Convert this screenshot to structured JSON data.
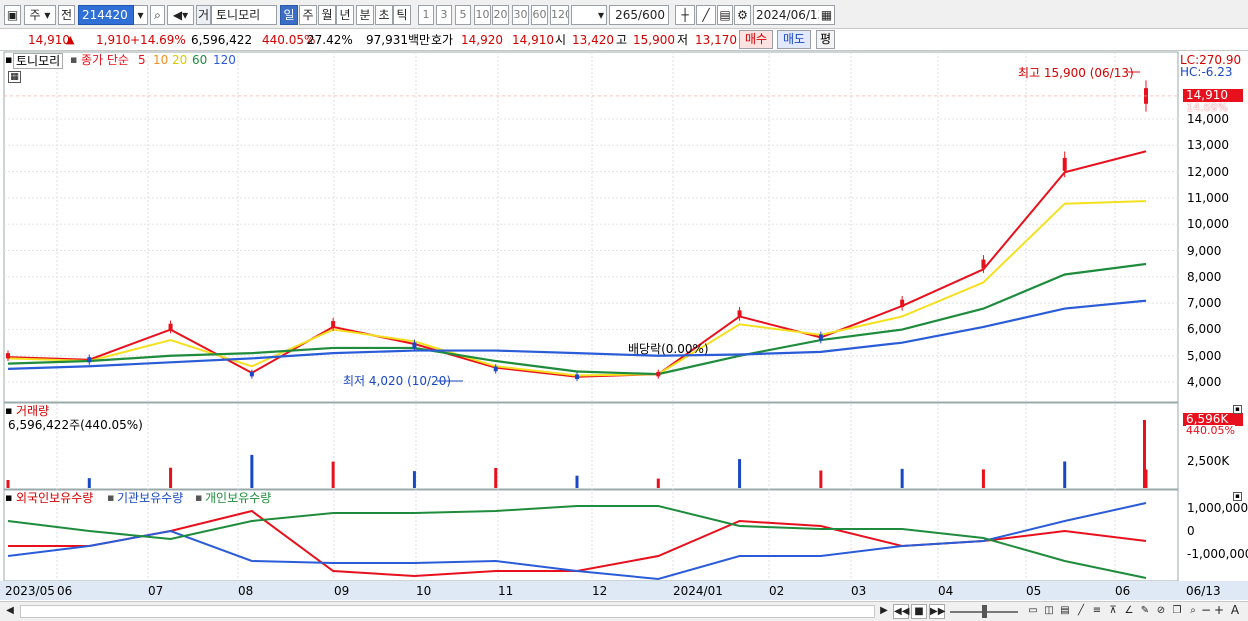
{
  "toolbar": {
    "market": "주",
    "jeon": "전",
    "code": "214420",
    "geo": "거",
    "name": "토니모리",
    "periods": [
      "일",
      "주",
      "월",
      "년",
      "분",
      "초",
      "틱"
    ],
    "selected_period": "일",
    "minutes": [
      "1",
      "3",
      "5",
      "10",
      "20",
      "30",
      "60",
      "120"
    ],
    "count": "265",
    "count_max": "/600",
    "date": "2024/06/13"
  },
  "quote": {
    "price": "14,910",
    "up_icon": "▲",
    "change": "1,910",
    "change_pct": "+14.69%",
    "volume": "6,596,422",
    "vol_ratio": "440.05%",
    "turnover": "27.42%",
    "amount": "97,931백만",
    "hoga_label": "호가",
    "ask": "14,920",
    "bid": "14,910",
    "open_label": "시",
    "open": "13,420",
    "high_label": "고",
    "high": "15,900",
    "low_label": "저",
    "low": "13,170",
    "buy_button": "매수",
    "sell_button": "매도",
    "eval_button": "평"
  },
  "price_panel": {
    "name": "토니모리",
    "ma_label": "종가 단순",
    "ma_periods": [
      "5",
      "10",
      "20",
      "60",
      "120"
    ],
    "ma_colors": [
      "#e8101c",
      "#f09020",
      "#f5e020",
      "#1e8c3c",
      "#2a5cd8"
    ],
    "lc": "LC:270.90",
    "hc": "HC:-6.23",
    "last_price": "14,910",
    "last_pct": "14.69%",
    "high_note": "최고 15,900 (06/13)",
    "low_note": "최저 4,020 (10/20)",
    "dividend_note": "배당락(0.00%)",
    "y_ticks": [
      "14,000",
      "13,000",
      "12,000",
      "11,000",
      "10,000",
      "9,000",
      "8,000",
      "7,000",
      "6,000",
      "5,000",
      "4,000"
    ]
  },
  "volume_panel": {
    "title": "거래량",
    "value": "6,596,422주(440.05%)",
    "tag": "6,596K",
    "tag_pct": "440.05%",
    "y_ticks": [
      "2,500K"
    ]
  },
  "holding_panel": {
    "foreign": "외국인보유수량",
    "institution": "기관보유수량",
    "individual": "개인보유수량",
    "y_ticks": [
      "1,000,000",
      "0",
      "-1,000,000"
    ]
  },
  "x_axis": [
    "2023/05",
    "06",
    "07",
    "08",
    "09",
    "10",
    "11",
    "12",
    "2024/01",
    "02",
    "03",
    "04",
    "05",
    "06",
    "06/13"
  ],
  "chart_data": {
    "type": "line",
    "x": [
      "2023/05",
      "2023/06",
      "2023/07",
      "2023/08",
      "2023/09",
      "2023/10",
      "2023/11",
      "2023/12",
      "2024/01",
      "2024/02",
      "2024/03",
      "2024/04",
      "2024/05",
      "2024/06",
      "2024/06/13"
    ],
    "series": [
      {
        "name": "종가",
        "values": [
          5000,
          4850,
          6100,
          4300,
          6200,
          5400,
          4500,
          4200,
          4300,
          6600,
          5700,
          7000,
          8500,
          12300,
          14910
        ]
      },
      {
        "name": "5",
        "values": [
          4950,
          4850,
          6000,
          4350,
          6100,
          5450,
          4550,
          4200,
          4300,
          6500,
          5700,
          6900,
          8300,
          12000,
          12800
        ]
      },
      {
        "name": "20",
        "values": [
          4900,
          4800,
          5600,
          4600,
          6000,
          5550,
          4600,
          4250,
          4300,
          6200,
          5800,
          6500,
          7800,
          10800,
          10900
        ]
      },
      {
        "name": "60",
        "values": [
          4700,
          4800,
          5000,
          5100,
          5300,
          5300,
          4800,
          4400,
          4300,
          5000,
          5600,
          6000,
          6800,
          8100,
          8500
        ]
      },
      {
        "name": "120",
        "values": [
          4500,
          4600,
          4750,
          4900,
          5100,
          5200,
          5200,
          5100,
          5000,
          5050,
          5150,
          5500,
          6100,
          6800,
          7100
        ]
      }
    ],
    "ylim": [
      4000,
      15900
    ]
  }
}
